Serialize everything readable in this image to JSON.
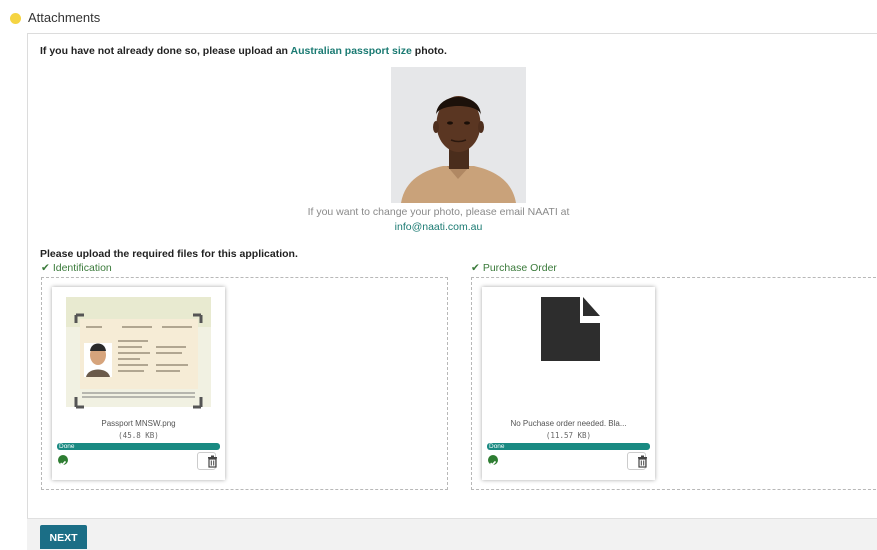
{
  "section": {
    "title": "Attachments",
    "status_color": "#f5d442"
  },
  "photo_request": {
    "text_before": "If you have not already done so, please upload an ",
    "link_text": "Australian passport size",
    "text_after": " photo.",
    "change_note": "If you want to change your photo, please email NAATI at",
    "email": "info@naati.com.au"
  },
  "files": {
    "title": "Please upload the required files for this application.",
    "groups": [
      {
        "label": "Identification",
        "file_name": "Passport MNSW.png",
        "file_size": "(45.8 KB)",
        "status": "Done",
        "progress": 1.0
      },
      {
        "label": "Purchase Order",
        "file_name": "No Puchase order needed. Bla...",
        "file_size": "(11.57 KB)",
        "status": "Done",
        "progress": 1.0
      }
    ]
  },
  "actions": {
    "next_label": "NEXT"
  },
  "colors": {
    "accent": "#1a7a72",
    "progress": "#1a8a82",
    "button": "#1b6e86",
    "check": "#3a7a3a"
  }
}
